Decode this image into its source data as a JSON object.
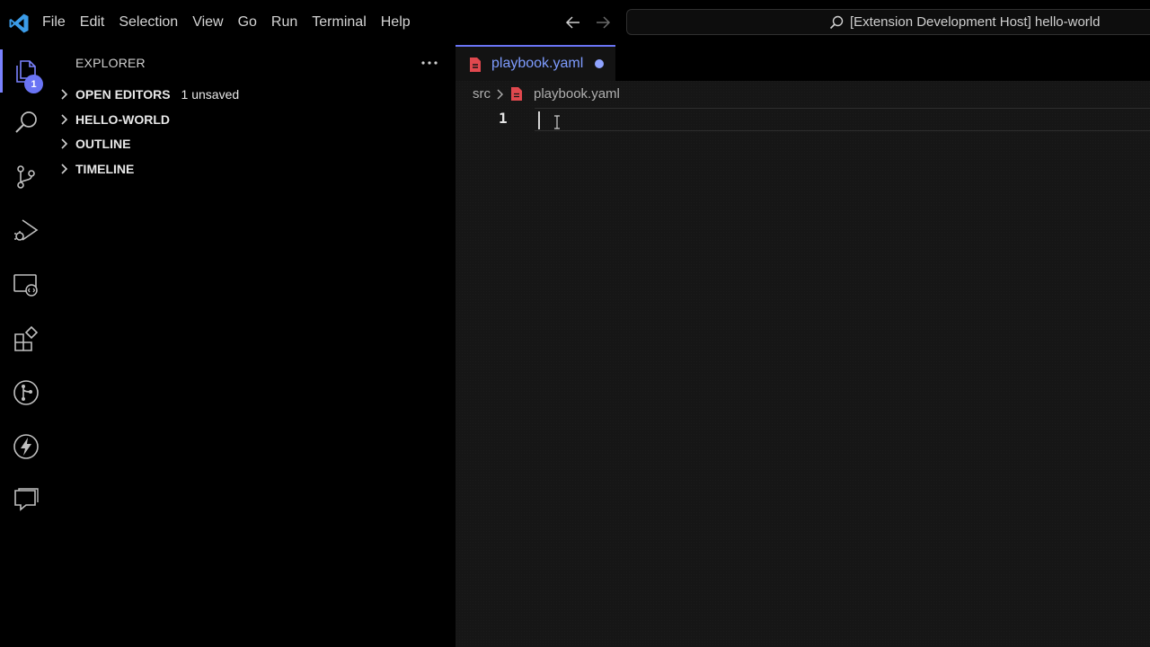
{
  "titlebar": {
    "menu": [
      "File",
      "Edit",
      "Selection",
      "View",
      "Go",
      "Run",
      "Terminal",
      "Help"
    ],
    "command_center_text": "[Extension Development Host] hello-world"
  },
  "activitybar": {
    "explorer_badge": "1",
    "items": [
      {
        "name": "explorer",
        "icon": "files-icon"
      },
      {
        "name": "search",
        "icon": "search-icon"
      },
      {
        "name": "source-control",
        "icon": "source-control-icon"
      },
      {
        "name": "run-and-debug",
        "icon": "run-debug-icon"
      },
      {
        "name": "remote-explorer",
        "icon": "remote-explorer-icon"
      },
      {
        "name": "extensions",
        "icon": "extensions-icon"
      },
      {
        "name": "git-graph",
        "icon": "git-graph-icon"
      },
      {
        "name": "lightning",
        "icon": "lightning-icon"
      },
      {
        "name": "comments",
        "icon": "comments-icon"
      }
    ]
  },
  "sidebar": {
    "title": "EXPLORER",
    "sections": [
      {
        "label": "OPEN EDITORS",
        "badge": "1 unsaved"
      },
      {
        "label": "HELLO-WORLD",
        "badge": ""
      },
      {
        "label": "OUTLINE",
        "badge": ""
      },
      {
        "label": "TIMELINE",
        "badge": ""
      }
    ]
  },
  "editor": {
    "tab_label": "playbook.yaml",
    "breadcrumb": {
      "folder": "src",
      "file": "playbook.yaml"
    },
    "line_number": "1"
  },
  "colors": {
    "accent": "#6a74f5",
    "tab_text": "#7e9cff",
    "yaml_icon": "#e0484e"
  }
}
